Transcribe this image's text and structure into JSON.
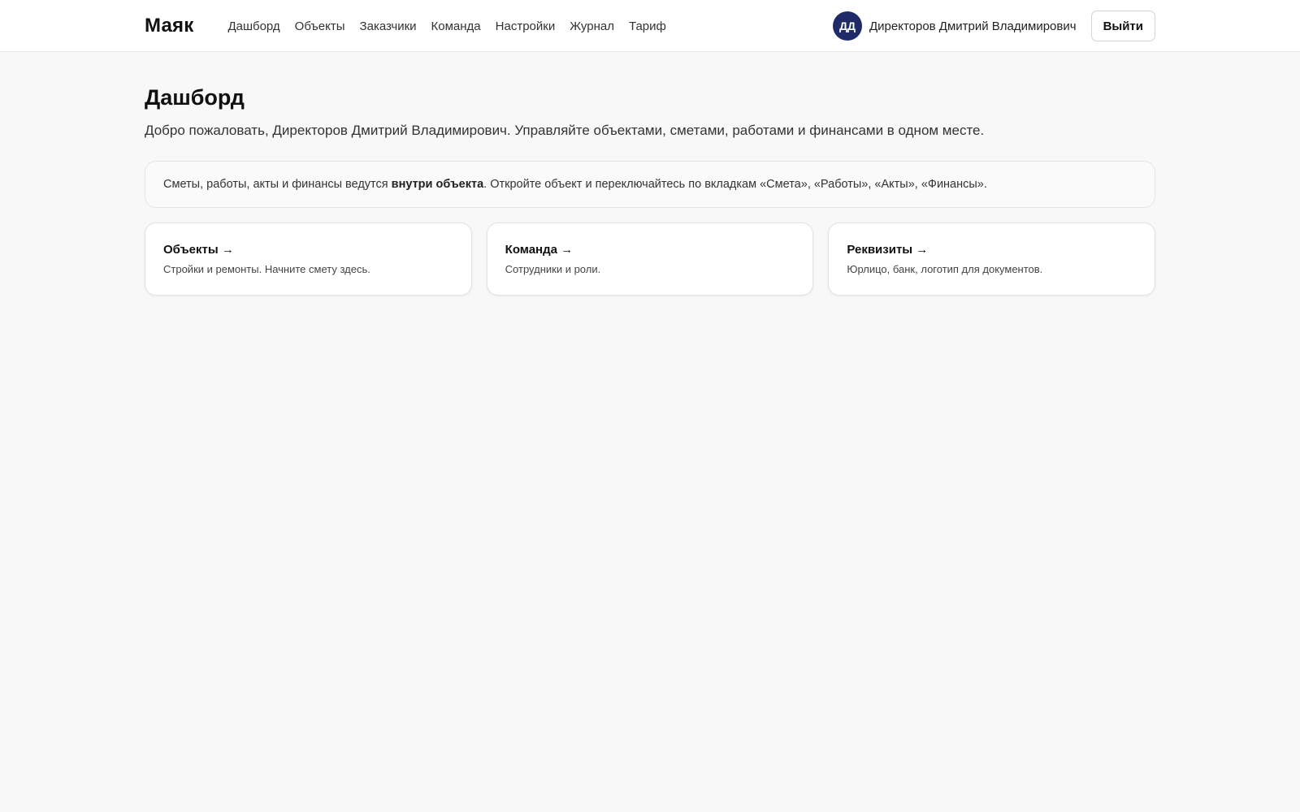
{
  "header": {
    "brand": "Маяк",
    "nav": [
      {
        "label": "Дашборд"
      },
      {
        "label": "Объекты"
      },
      {
        "label": "Заказчики"
      },
      {
        "label": "Команда"
      },
      {
        "label": "Настройки"
      },
      {
        "label": "Журнал"
      },
      {
        "label": "Тариф"
      }
    ],
    "user": {
      "initials": "ДД",
      "name": "Директоров Дмитрий Владимирович",
      "avatar_color": "#1f2a66"
    },
    "logout_label": "Выйти"
  },
  "main": {
    "title": "Дашборд",
    "subtitle": "Добро пожаловать, Директоров Дмитрий Владимирович. Управляйте объектами, сметами, работами и финансами в одном месте.",
    "notice": {
      "part1": "Сметы, работы, акты и финансы ведутся ",
      "bold": "внутри объекта",
      "part2": ". Откройте объект и переключайтесь по вкладкам «Смета», «Работы», «Акты», «Финансы»."
    },
    "cards": [
      {
        "title": "Объекты →",
        "description": "Стройки и ремонты. Начните смету здесь."
      },
      {
        "title": "Команда →",
        "description": "Сотрудники и роли."
      },
      {
        "title": "Реквизиты →",
        "description": "Юрлицо, банк, логотип для документов."
      }
    ]
  }
}
